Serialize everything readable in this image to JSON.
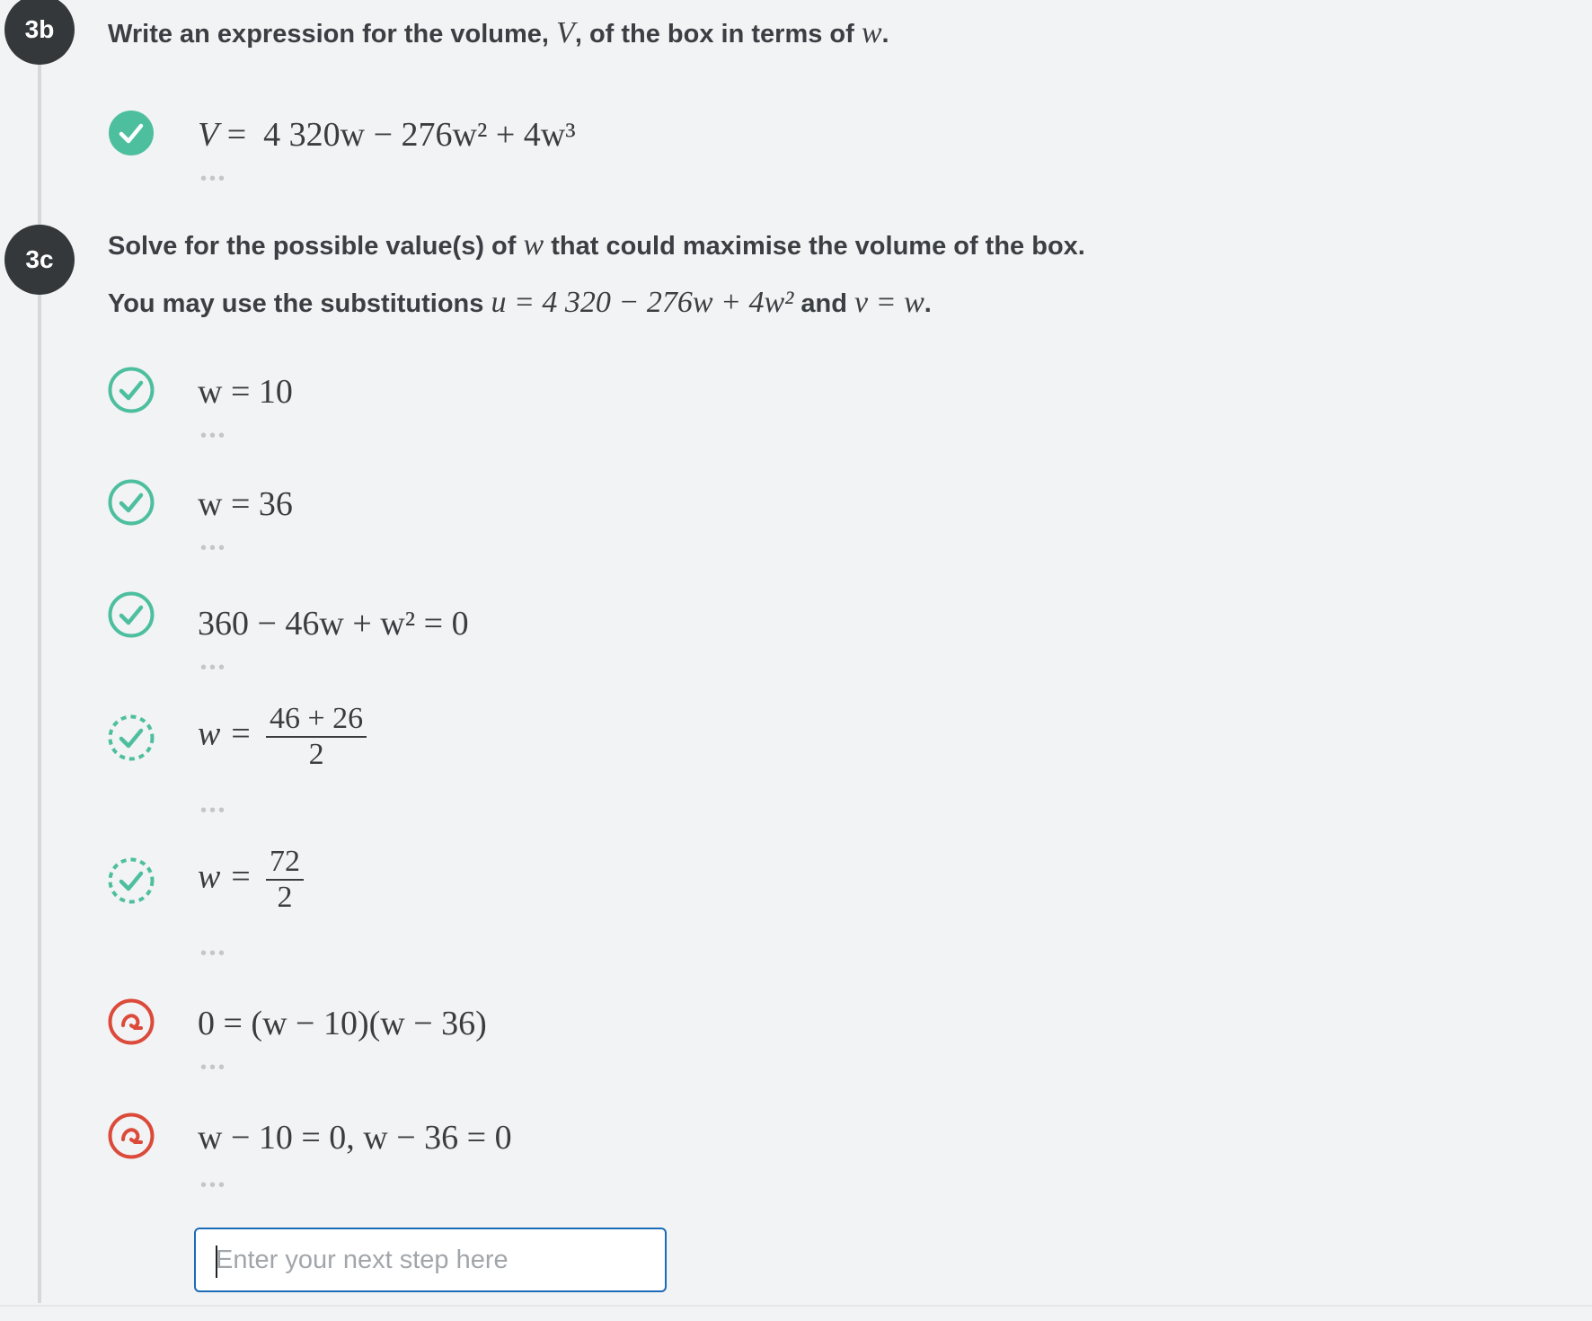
{
  "colors": {
    "correct": "#4dbf9f",
    "error": "#db4a3a",
    "badge": "#35383b",
    "input_border": "#1c6bb7"
  },
  "part_b": {
    "badge": "3b",
    "prompt": {
      "p1": "Write an expression for the volume,",
      "v": "V",
      "p2": ", of the box in terms of",
      "w": "w",
      "end": "."
    },
    "steps": [
      {
        "status": "correct-filled-icon",
        "lhs": "V",
        "eq": " = ",
        "rhs": "4 320w − 276w² + 4w³"
      }
    ]
  },
  "part_c": {
    "badge": "3c",
    "prompt_line1": {
      "p1": "Solve for the possible value(s) of",
      "w": "w",
      "p2": "that could maximise the volume of the box."
    },
    "prompt_line2": {
      "p1": "You may use the substitutions",
      "u": "u = 4 320 − 276w + 4w²",
      "and": "and",
      "v": "v = w",
      "end": "."
    },
    "steps": [
      {
        "status": "correct-outline-icon",
        "expr": "w = 10"
      },
      {
        "status": "correct-outline-icon",
        "expr": "w = 36"
      },
      {
        "status": "correct-outline-icon",
        "expr": "360 − 46w + w² = 0"
      },
      {
        "status": "correct-dashed-icon",
        "lhs": "w =",
        "num": "46 + 26",
        "den": "2"
      },
      {
        "status": "correct-dashed-icon",
        "lhs": "w =",
        "num": "72",
        "den": "2"
      },
      {
        "status": "retry-icon",
        "expr": "0 = (w − 10)(w − 36)"
      },
      {
        "status": "retry-icon",
        "expr": "w − 10 = 0,  w − 36 = 0"
      }
    ],
    "dots": "•••"
  },
  "input": {
    "placeholder": "Enter your next step here"
  }
}
